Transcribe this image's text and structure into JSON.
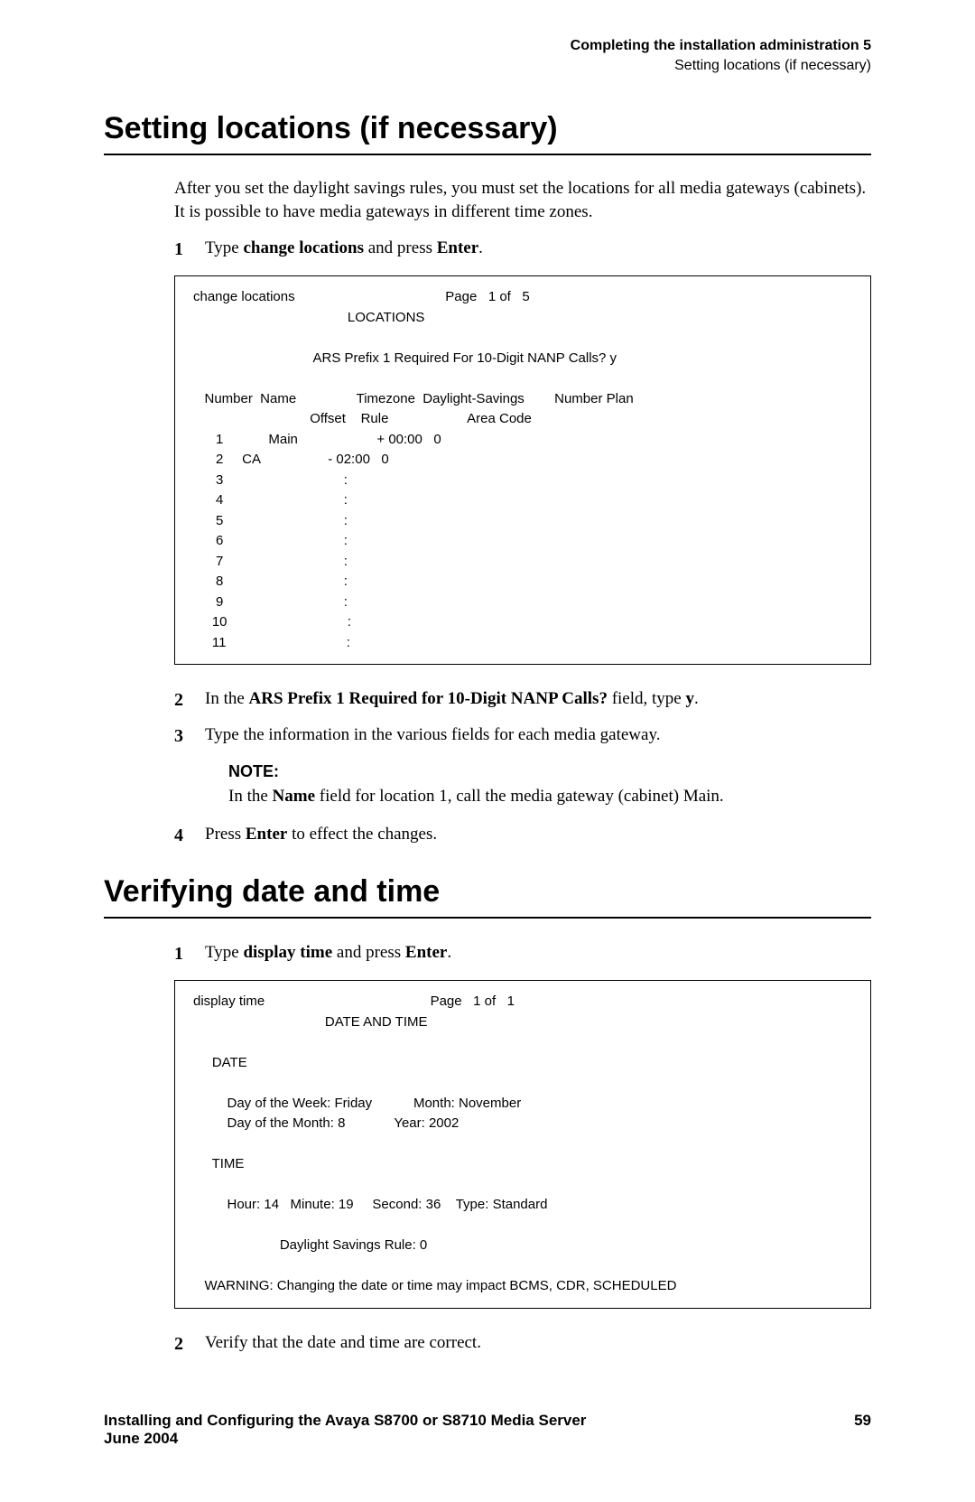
{
  "header": {
    "line1": "Completing the installation administration 5",
    "line2": "Setting locations (if necessary)"
  },
  "section1": {
    "title": "Setting locations (if necessary)",
    "intro": "After you set the daylight savings rules, you must set the locations for all media gateways (cabinets). It is possible to have media gateways in different time zones.",
    "step1_pre": "Type ",
    "step1_cmd": "change locations",
    "step1_mid": " and press ",
    "step1_key": "Enter",
    "step1_post": ".",
    "terminal": "change locations                                        Page   1 of   5\n                                         LOCATIONS\n\n                                ARS Prefix 1 Required For 10-Digit NANP Calls? y\n\n   Number  Name                Timezone  Daylight-Savings        Number Plan\n                               Offset    Rule                     Area Code\n      1            Main                     + 00:00   0\n      2     CA                  - 02:00   0\n      3                                :\n      4                                :\n      5                                :\n      6                                :\n      7                                :\n      8                                :\n      9                                :\n     10                                :\n     11                                :",
    "step2_pre": "In the ",
    "step2_field": "ARS Prefix 1 Required for 10-Digit NANP Calls?",
    "step2_mid": " field, type ",
    "step2_val": "y",
    "step2_post": ".",
    "step3": "Type the information in the various fields for each media gateway.",
    "note_label": "NOTE:",
    "note_pre": "In the ",
    "note_field": "Name",
    "note_post": " field for location 1, call the media gateway (cabinet) Main.",
    "step4_pre": "Press ",
    "step4_key": "Enter",
    "step4_post": " to effect the changes."
  },
  "section2": {
    "title": "Verifying date and time",
    "step1_pre": "Type ",
    "step1_cmd": "display time",
    "step1_mid": " and press ",
    "step1_key": "Enter",
    "step1_post": ".",
    "terminal": "display time                                            Page   1 of   1\n                                   DATE AND TIME\n\n     DATE\n\n         Day of the Week: Friday           Month: November\n         Day of the Month: 8             Year: 2002\n\n     TIME\n\n         Hour: 14   Minute: 19     Second: 36    Type: Standard\n\n                       Daylight Savings Rule: 0\n\n   WARNING: Changing the date or time may impact BCMS, CDR, SCHEDULED",
    "step2": "Verify that the date and time are correct."
  },
  "footer": {
    "title": "Installing and Configuring the Avaya S8700 or S8710 Media Server",
    "date": "June 2004",
    "page": "59"
  }
}
